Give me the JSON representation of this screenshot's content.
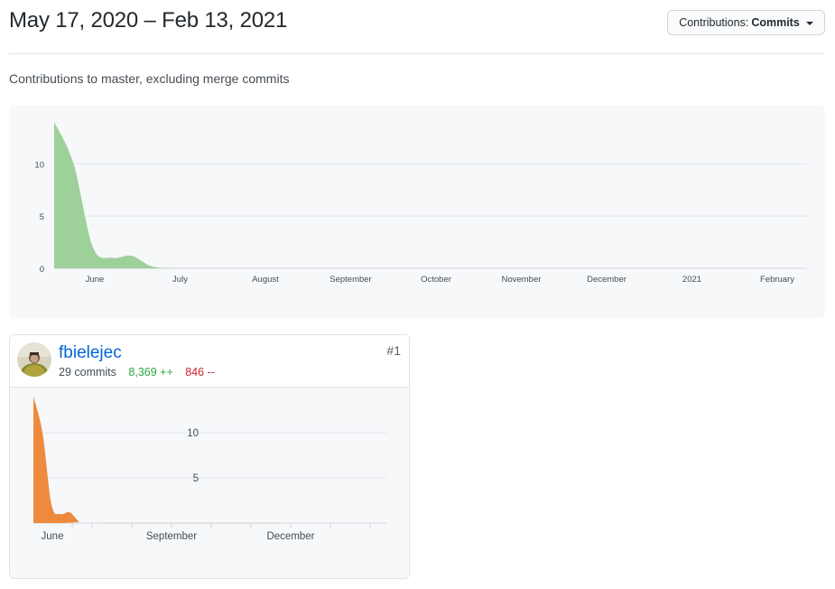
{
  "header": {
    "date_range": "May 17, 2020 – Feb 13, 2021",
    "contributions_label": "Contributions:",
    "contributions_value": "Commits"
  },
  "subtitle": "Contributions to master, excluding merge commits",
  "chart_data": [
    {
      "type": "area",
      "title": "",
      "color": "#9ed09a",
      "ylim": [
        0,
        14
      ],
      "y_ticks": [
        "0",
        "5",
        "10"
      ],
      "x_tick_labels": [
        "June",
        "July",
        "August",
        "September",
        "October",
        "November",
        "December",
        "2021",
        "February"
      ],
      "x": [
        "2020-05-17",
        "2020-05-24",
        "2020-05-31",
        "2020-06-07",
        "2020-06-14",
        "2020-06-21",
        "2020-06-28",
        "2020-07-05",
        "2021-02-13"
      ],
      "values": [
        14,
        10,
        2,
        1,
        1.2,
        0.2,
        0,
        0,
        0
      ],
      "grid": true
    },
    {
      "type": "area",
      "title": "",
      "color": "#ee8a3e",
      "ylim": [
        0,
        14
      ],
      "y_ticks": [
        "5",
        "10"
      ],
      "x_tick_labels": [
        "June",
        "September",
        "December"
      ],
      "x": [
        "2020-05-17",
        "2020-05-24",
        "2020-05-31",
        "2020-06-07",
        "2020-06-14",
        "2020-06-21",
        "2020-06-28",
        "2021-02-13"
      ],
      "values": [
        14,
        10,
        2,
        1,
        1.2,
        0.2,
        0,
        0
      ],
      "grid": true
    }
  ],
  "contributor": {
    "username": "fbielejec",
    "commits": "29 commits",
    "additions": "8,369 ++",
    "deletions": "846 --",
    "rank": "#1"
  }
}
